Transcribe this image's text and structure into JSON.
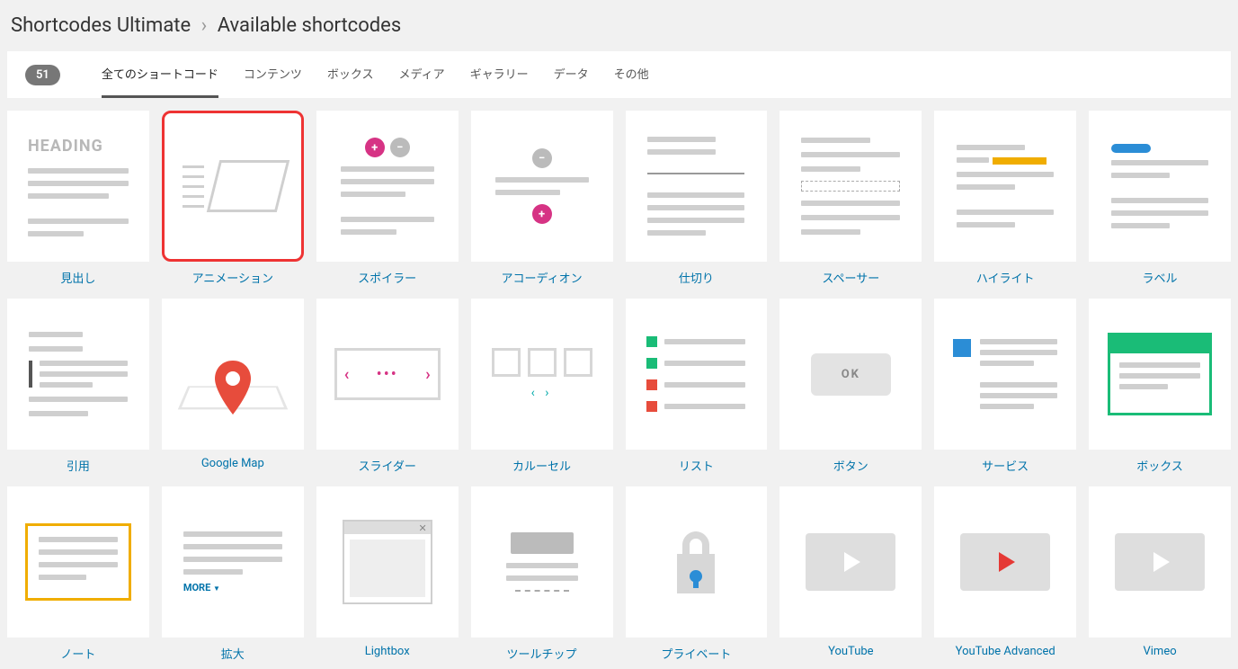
{
  "breadcrumb": {
    "root": "Shortcodes Ultimate",
    "sep": "›",
    "page": "Available shortcodes"
  },
  "count": "51",
  "tabs": [
    {
      "label": "全てのショートコード",
      "active": true
    },
    {
      "label": "コンテンツ"
    },
    {
      "label": "ボックス"
    },
    {
      "label": "メディア"
    },
    {
      "label": "ギャラリー"
    },
    {
      "label": "データ"
    },
    {
      "label": "その他"
    }
  ],
  "items": [
    {
      "label": "見出し",
      "kind": "heading",
      "highlight": false,
      "heading_text": "HEADING"
    },
    {
      "label": "アニメーション",
      "kind": "animation",
      "highlight": true
    },
    {
      "label": "スポイラー",
      "kind": "spoiler"
    },
    {
      "label": "アコーディオン",
      "kind": "accordion"
    },
    {
      "label": "仕切り",
      "kind": "divider"
    },
    {
      "label": "スペーサー",
      "kind": "spacer"
    },
    {
      "label": "ハイライト",
      "kind": "highlight"
    },
    {
      "label": "ラベル",
      "kind": "label"
    },
    {
      "label": "引用",
      "kind": "quote"
    },
    {
      "label": "Google Map",
      "kind": "gmap"
    },
    {
      "label": "スライダー",
      "kind": "slider"
    },
    {
      "label": "カルーセル",
      "kind": "carousel"
    },
    {
      "label": "リスト",
      "kind": "list"
    },
    {
      "label": "ボタン",
      "kind": "button",
      "button_text": "OK"
    },
    {
      "label": "サービス",
      "kind": "service"
    },
    {
      "label": "ボックス",
      "kind": "box"
    },
    {
      "label": "ノート",
      "kind": "note"
    },
    {
      "label": "拡大",
      "kind": "expand",
      "more_text": "MORE"
    },
    {
      "label": "Lightbox",
      "kind": "lightbox"
    },
    {
      "label": "ツールチップ",
      "kind": "tooltip"
    },
    {
      "label": "プライベート",
      "kind": "private"
    },
    {
      "label": "YouTube",
      "kind": "yt"
    },
    {
      "label": "YouTube Advanced",
      "kind": "yt_red"
    },
    {
      "label": "Vimeo",
      "kind": "yt"
    }
  ]
}
